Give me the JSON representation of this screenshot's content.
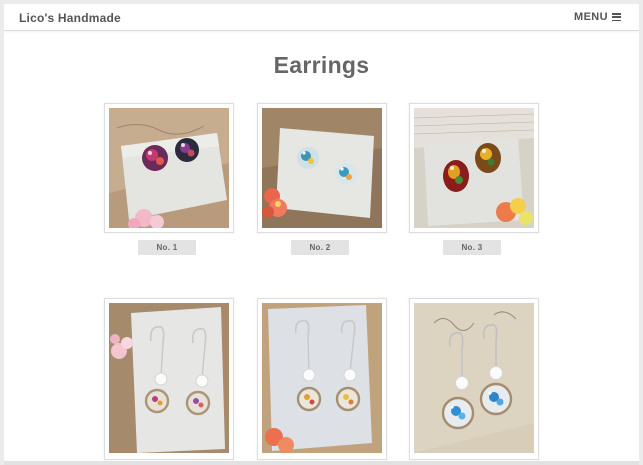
{
  "header": {
    "brand": "Lico's Handmade",
    "menu_label": "MENU",
    "menu_icon": "hamburger-icon"
  },
  "page": {
    "title": "Earrings"
  },
  "products": [
    {
      "label": "No. 1"
    },
    {
      "label": "No. 2"
    },
    {
      "label": "No. 3"
    }
  ],
  "colors": {
    "text": "#555555",
    "title": "#666666",
    "label_bg": "#e3e3e3"
  }
}
